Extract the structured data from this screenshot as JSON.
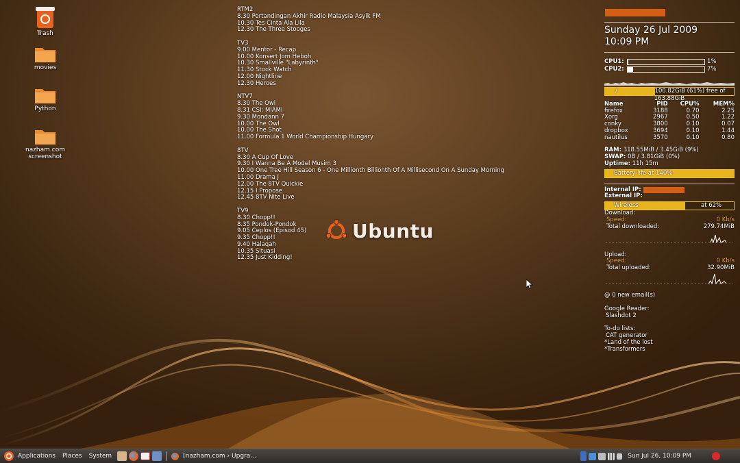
{
  "desktop_icons": [
    {
      "label": "Trash",
      "icon": "trash-icon"
    },
    {
      "label": "movies",
      "icon": "folder-icon"
    },
    {
      "label": "Python",
      "icon": "folder-icon"
    },
    {
      "label": "nazham.com screenshot",
      "icon": "folder-icon"
    }
  ],
  "tv_schedule": [
    {
      "channel": "RTM2",
      "items": [
        "8.30 Pertandingan Akhir Radio Malaysia Asyik FM",
        "10.30 Tes Cinta Ala Lila",
        "12.30 The Three Stooges"
      ]
    },
    {
      "channel": "TV3",
      "items": [
        "9.00 Mentor - Recap",
        "10.00 Konsert Jom Heboh",
        "10.30 Smallville \"Labyrinth\"",
        "11.30 Stock Watch",
        "12.00 Nightline",
        "12.30 Heroes"
      ]
    },
    {
      "channel": "NTV7",
      "items": [
        "8.30 The Owl",
        "8.31 CSI: MIAMI",
        "9.30 Mondann 7",
        "10.00 The Owl",
        "10.00 The Shot",
        "11.00 Formula 1 World Championship Hungary"
      ]
    },
    {
      "channel": "8TV",
      "items": [
        "8.30 A Cup Of Love",
        "9.30 I Wanna Be A Model Musim 3",
        "10.00 One Tree Hill Season 6 - One Millionth Billionth Of A Millisecond On A Sunday Morning",
        "11.00 Drama J",
        "12.00 The 8TV Quickie",
        "12.15 I Propose",
        "12.45 8TV Nite Live"
      ]
    },
    {
      "channel": "TV9",
      "items": [
        "8.30 Chopp!!",
        "8.35 Pondok-Pondok",
        "9.05 Ceplos (Episod 45)",
        "9.35 Chopp!!",
        "9.40 Halaqah",
        "10.35 Situasi",
        "12.35 Just Kidding!"
      ]
    }
  ],
  "wallpaper": {
    "logo_text": "Ubuntu"
  },
  "conky": {
    "date": "Sunday 26 Jul 2009",
    "time": "10:09 PM",
    "cpu1": {
      "label": "CPU1:",
      "percent": 1,
      "text": "1%"
    },
    "cpu2": {
      "label": "CPU2:",
      "percent": 7,
      "text": "7%"
    },
    "disk": {
      "mount": "/",
      "text": "100.82GiB (61%) free of 163.88GiB",
      "used_fraction": 0.39
    },
    "proc_header": {
      "name": "Name",
      "pid": "PID",
      "cpu": "CPU%",
      "mem": "MEM%"
    },
    "processes": [
      {
        "name": "firefox",
        "pid": "3188",
        "cpu": "0.70",
        "mem": "2.25"
      },
      {
        "name": "Xorg",
        "pid": "2967",
        "cpu": "0.50",
        "mem": "1.22"
      },
      {
        "name": "conky",
        "pid": "3800",
        "cpu": "0.10",
        "mem": "0.07"
      },
      {
        "name": "dropbox",
        "pid": "3694",
        "cpu": "0.10",
        "mem": "1.44"
      },
      {
        "name": "nautilus",
        "pid": "3570",
        "cpu": "0.10",
        "mem": "0.80"
      }
    ],
    "ram_label": "RAM:",
    "ram": "318.55MiB / 3.45GiB (9%)",
    "swap_label": "SWAP:",
    "swap": "0B / 3.81GiB (0%)",
    "uptime_label": "Uptime:",
    "uptime": "11h 15m",
    "battery": {
      "text": "Battery life at 140%",
      "fill": 1.0
    },
    "internal_ip_label": "Internal IP:",
    "external_ip_label": "External IP:",
    "wireless": {
      "label": "Wireless",
      "text": "at 62%",
      "fill": 0.62
    },
    "download_label": "Download:",
    "down_speed_label": "Speed:",
    "down_speed": "0 Kb/s",
    "total_down_label": "Total downloaded:",
    "total_down": "279.74MiB",
    "upload_label": "Upload:",
    "up_speed_label": "Speed:",
    "up_speed": "0 Kb/s",
    "total_up_label": "Total uploaded:",
    "total_up": "32.90MiB",
    "email": "@ 0 new email(s)",
    "reader_label": "Google Reader:",
    "reader_item": "Slashdot 2",
    "todo_label": "To-do lists:",
    "todo_items": [
      "CAT generator",
      "*Land of the lost",
      "*Transformers"
    ]
  },
  "taskbar": {
    "menus": [
      "Applications",
      "Places",
      "System"
    ],
    "window_title": "[nazham.com › Upgra...",
    "clock": "Sun Jul 26, 10:09 PM"
  }
}
